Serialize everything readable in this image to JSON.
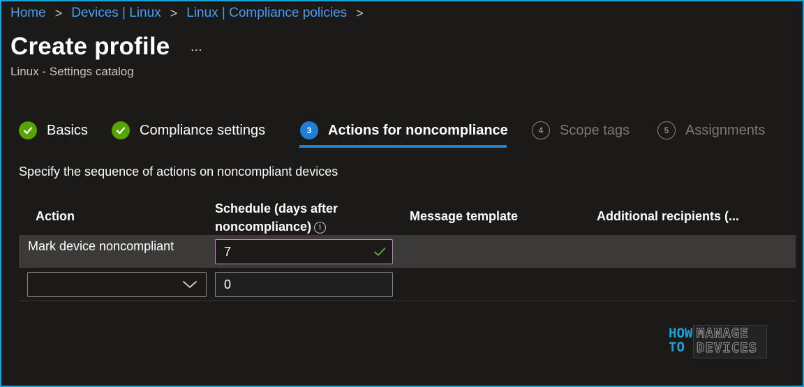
{
  "breadcrumb": {
    "items": [
      "Home",
      "Devices | Linux",
      "Linux | Compliance policies"
    ],
    "separator": ">"
  },
  "page": {
    "title": "Create profile",
    "more": "...",
    "subtitle": "Linux - Settings catalog"
  },
  "wizard": {
    "steps": [
      {
        "label": "Basics",
        "state": "completed"
      },
      {
        "label": "Compliance settings",
        "state": "completed"
      },
      {
        "number": "3",
        "label": "Actions for noncompliance",
        "state": "active"
      },
      {
        "number": "4",
        "label": "Scope tags",
        "state": "inactive"
      },
      {
        "number": "5",
        "label": "Assignments",
        "state": "inactive"
      }
    ]
  },
  "content": {
    "description": "Specify the sequence of actions on noncompliant devices",
    "table": {
      "headers": {
        "action": "Action",
        "schedule_line1": "Schedule (days after",
        "schedule_line2": "noncompliance)",
        "message": "Message template",
        "recipients": "Additional recipients (..."
      },
      "rows": [
        {
          "action": "Mark device noncompliant",
          "schedule": "7"
        },
        {
          "action": "",
          "schedule": "0"
        }
      ]
    }
  },
  "watermark": {
    "how": "HOW",
    "to": "TO",
    "manage": "MANAGE",
    "devices": "DEVICES"
  },
  "colors": {
    "accent": "#1d7fd8",
    "link": "#479ef5",
    "success": "#57a300",
    "focus_border": "#c77dd8",
    "frame": "#1aa3d9"
  }
}
